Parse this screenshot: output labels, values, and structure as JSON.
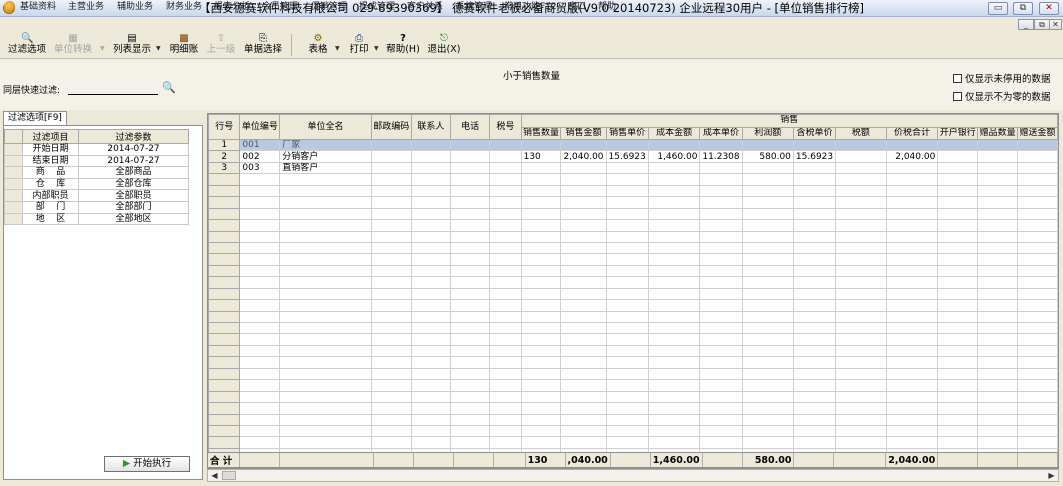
{
  "window": {
    "title": "【西安德赛软件科技有限公司 029-89390369】 德赛软件老板必备商贸版(V9.0 20140723) 企业远程30用户 - [单位销售排行榜]",
    "min": "▭",
    "restore": "⧉",
    "close": "✕"
  },
  "menu": {
    "items": [
      "基础资料",
      "主营业务",
      "辅助业务",
      "财务业务",
      "报表分析",
      "会员管理",
      "促销管理",
      "提成管理",
      "客户关系",
      "系统管理",
      "常用功能F12",
      "窗口",
      "帮助"
    ],
    "mdi_min": "_",
    "mdi_restore": "⧉",
    "mdi_close": "✕"
  },
  "toolbar": {
    "filter_options": "过滤选项",
    "unit_convert": "单位转换",
    "list_display": "列表显示",
    "details": "明细账",
    "up_level": "上一级",
    "doc_select": "单据选择",
    "table": "表格",
    "print": "打印",
    "help": "帮助(H)",
    "exit": "退出(X)"
  },
  "top": {
    "filter_label": "同层快速过滤:",
    "filter_value": "",
    "report_title": "小于销售数量",
    "show_disabled": "仅显示未停用的数据",
    "show_nonzero": "仅显示不为零的数据"
  },
  "left": {
    "tab": "过滤选项[F9]",
    "col_item": "过滤项目",
    "col_param": "过滤参数",
    "rows": [
      {
        "item": "开始日期",
        "param": "2014-07-27"
      },
      {
        "item": "结束日期",
        "param": "2014-07-27"
      },
      {
        "item": "商    品",
        "param": "全部商品"
      },
      {
        "item": "仓    库",
        "param": "全部仓库"
      },
      {
        "item": "内部职员",
        "param": "全部职员"
      },
      {
        "item": "部    门",
        "param": "全部部门"
      },
      {
        "item": "地    区",
        "param": "全部地区"
      }
    ],
    "execute": "开始执行"
  },
  "grid": {
    "group_sales": "销售",
    "headers": {
      "row_no": "行号",
      "unit_code": "单位编号",
      "unit_name": "单位全名",
      "postcode": "邮政编码",
      "contact": "联系人",
      "phone": "电话",
      "tax_no": "税号",
      "qty": "销售数量",
      "amount": "销售金额",
      "price": "销售单价",
      "cost_amount": "成本金额",
      "cost_price": "成本单价",
      "profit": "利润额",
      "tax_price": "含税单价",
      "tax": "税额",
      "total": "价税合计",
      "bank": "开户银行",
      "gift_qty": "赠品数量",
      "gift_amount": "赠送金额"
    },
    "rows": [
      {
        "no": "1",
        "code": "001",
        "name": "厂家",
        "qty": "",
        "amount": "",
        "price": "",
        "cost_amount": "",
        "cost_price": "",
        "profit": "",
        "tax_price": "",
        "total": ""
      },
      {
        "no": "2",
        "code": "002",
        "name": "分销客户",
        "qty": "130",
        "amount": "2,040.00",
        "price": "15.6923",
        "cost_amount": "1,460.00",
        "cost_price": "11.2308",
        "profit": "580.00",
        "tax_price": "15.6923",
        "total": "2,040.00"
      },
      {
        "no": "3",
        "code": "003",
        "name": "直销客户",
        "qty": "",
        "amount": "",
        "price": "",
        "cost_amount": "",
        "cost_price": "",
        "profit": "",
        "tax_price": "",
        "total": ""
      }
    ],
    "totals": {
      "label": "合 计",
      "qty": "130",
      "amount": ",040.00",
      "cost_amount": "1,460.00",
      "profit": "580.00",
      "total": "2,040.00"
    }
  },
  "colors": {
    "selected_row": "#b9c9e2",
    "header_bg": "#ece9d8"
  }
}
